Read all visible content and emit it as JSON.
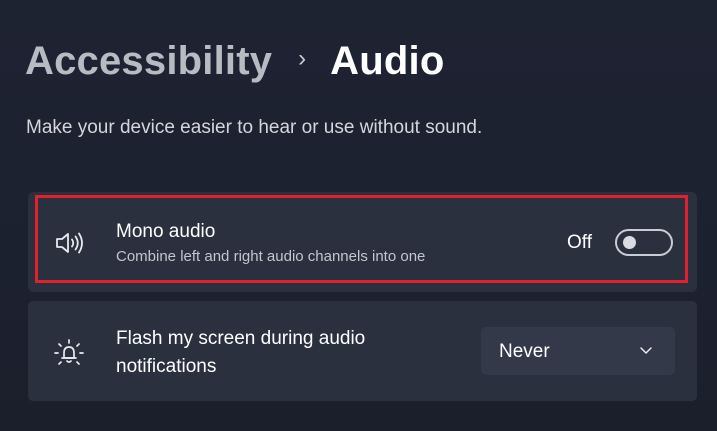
{
  "breadcrumb": {
    "parent": "Accessibility",
    "separator": "›",
    "current": "Audio"
  },
  "description": "Make your device easier to hear or use without sound.",
  "settings": {
    "mono_audio": {
      "icon": "speaker-icon",
      "title": "Mono audio",
      "subtitle": "Combine left and right audio channels into one",
      "state_label": "Off",
      "enabled": false
    },
    "flash_screen": {
      "icon": "flash-notification-icon",
      "title": "Flash my screen during audio notifications",
      "selected_option": "Never"
    }
  },
  "colors": {
    "background": "#1d2230",
    "card": "#2b303e",
    "highlight": "#e0212f"
  }
}
